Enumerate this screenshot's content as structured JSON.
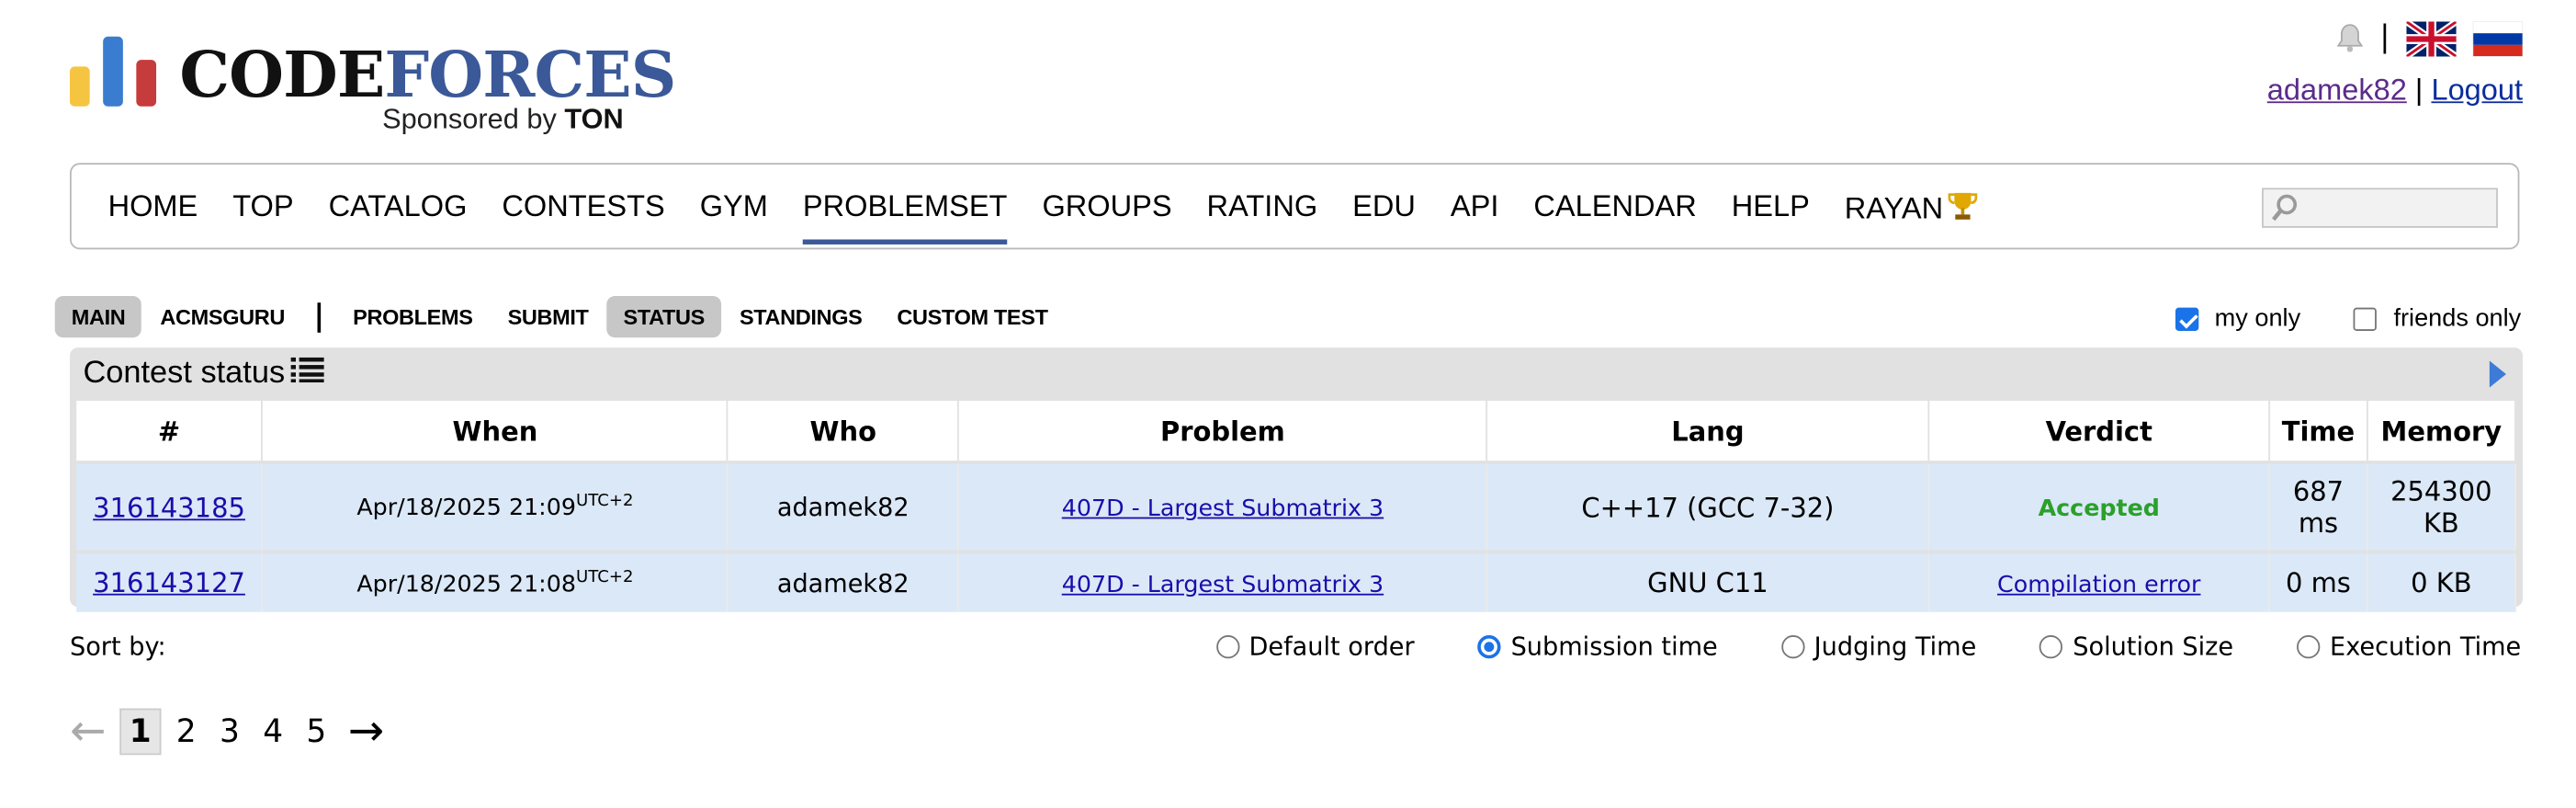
{
  "header": {
    "logo_text_a": "CODE",
    "logo_text_b": "FORCES",
    "sponsor_text": "Sponsored by",
    "sponsor_brand": "TON",
    "separator": "|",
    "username": "adamek82",
    "logout_label": "Logout",
    "logo_colors": [
      "#f5c542",
      "#3a7ccf",
      "#c63b3b"
    ]
  },
  "menu": {
    "items": [
      "HOME",
      "TOP",
      "CATALOG",
      "CONTESTS",
      "GYM",
      "PROBLEMSET",
      "GROUPS",
      "RATING",
      "EDU",
      "API",
      "CALENDAR",
      "HELP",
      "RAYAN"
    ],
    "active": "PROBLEMSET",
    "search_placeholder": ""
  },
  "submenu": {
    "items": [
      "MAIN",
      "ACMSGURU",
      "PROBLEMS",
      "SUBMIT",
      "STATUS",
      "STANDINGS",
      "CUSTOM TEST"
    ],
    "selected": [
      "MAIN",
      "STATUS"
    ]
  },
  "filters": {
    "my_only_label": "my only",
    "my_only_checked": true,
    "friends_only_label": "friends only",
    "friends_only_checked": false
  },
  "status_panel": {
    "title": "Contest status",
    "columns": [
      "#",
      "When",
      "Who",
      "Problem",
      "Lang",
      "Verdict",
      "Time",
      "Memory"
    ],
    "rows": [
      {
        "id": "316143185",
        "when": "Apr/18/2025 21:09",
        "tz": "UTC+2",
        "who": "adamek82",
        "problem": "407D - Largest Submatrix 3",
        "lang": "C++17 (GCC 7-32)",
        "verdict": "Accepted",
        "time": "687 ms",
        "memory": "254300 KB"
      },
      {
        "id": "316143127",
        "when": "Apr/18/2025 21:08",
        "tz": "UTC+2",
        "who": "adamek82",
        "problem": "407D - Largest Submatrix 3",
        "lang": "GNU C11",
        "verdict": "Compilation error",
        "time": "0 ms",
        "memory": "0 KB"
      }
    ]
  },
  "sort": {
    "label": "Sort by:",
    "options": [
      "Default order",
      "Submission time",
      "Judging Time",
      "Solution Size",
      "Execution Time"
    ],
    "selected": "Submission time"
  },
  "pagination": {
    "prev": "←",
    "next": "→",
    "pages": [
      "1",
      "2",
      "3",
      "4",
      "5"
    ],
    "current": "1"
  }
}
